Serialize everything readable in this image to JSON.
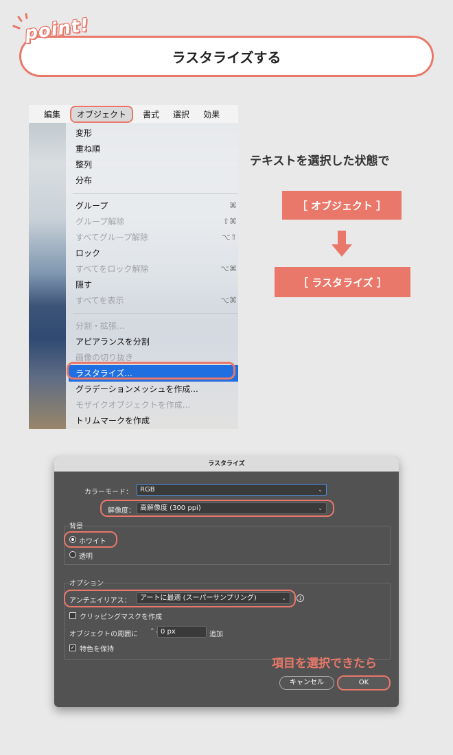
{
  "header": {
    "badge": "point!",
    "title": "ラスタライズする"
  },
  "menubar": [
    "編集",
    "オブジェクト",
    "書式",
    "選択",
    "効果"
  ],
  "dropdown": {
    "groups": [
      [
        {
          "label": "変形",
          "shortcut": "",
          "disabled": false
        },
        {
          "label": "重ね順",
          "shortcut": "",
          "disabled": false
        },
        {
          "label": "整列",
          "shortcut": "",
          "disabled": false
        },
        {
          "label": "分布",
          "shortcut": "",
          "disabled": false
        }
      ],
      [
        {
          "label": "グループ",
          "shortcut": "⌘",
          "disabled": false
        },
        {
          "label": "グループ解除",
          "shortcut": "⇧⌘",
          "disabled": true
        },
        {
          "label": "すべてグループ解除",
          "shortcut": "⌥⇧",
          "disabled": true
        },
        {
          "label": "ロック",
          "shortcut": "",
          "disabled": false
        },
        {
          "label": "すべてをロック解除",
          "shortcut": "⌥⌘",
          "disabled": true
        },
        {
          "label": "隠す",
          "shortcut": "",
          "disabled": false
        },
        {
          "label": "すべてを表示",
          "shortcut": "⌥⌘",
          "disabled": true
        }
      ],
      [
        {
          "label": "分割・拡張...",
          "shortcut": "",
          "disabled": true
        },
        {
          "label": "アピアランスを分割",
          "shortcut": "",
          "disabled": false
        },
        {
          "label": "画像の切り抜き",
          "shortcut": "",
          "disabled": true
        },
        {
          "label": "ラスタライズ...",
          "shortcut": "",
          "disabled": false,
          "selected": true
        },
        {
          "label": "グラデーションメッシュを作成...",
          "shortcut": "",
          "disabled": false
        },
        {
          "label": "モザイクオブジェクトを作成...",
          "shortcut": "",
          "disabled": true
        },
        {
          "label": "トリムマークを作成",
          "shortcut": "",
          "disabled": false
        }
      ]
    ]
  },
  "instructions": {
    "lead": "テキストを選択した状態で",
    "step1": "［ オブジェクト ］",
    "step2": "［ ラスタライズ ］"
  },
  "dialog": {
    "title": "ラスタライズ",
    "color_mode_label": "カラーモード：",
    "color_mode_value": "RGB",
    "resolution_label": "解像度：",
    "resolution_value": "高解像度 (300 ppi)",
    "background_label": "背景",
    "bg_white": "ホワイト",
    "bg_transparent": "透明",
    "options_label": "オプション",
    "antialias_label": "アンチエイリアス：",
    "antialias_value": "アートに最適 (スーパーサンプリング)",
    "clipping_mask": "クリッピングマスクを作成",
    "around_object_label": "オブジェクトの周囲に",
    "around_object_value": "0 px",
    "around_object_suffix": "追加",
    "preserve_spot": "特色を保持",
    "cancel": "キャンセル",
    "ok": "OK"
  },
  "note": "項目を選択できたら",
  "colors": {
    "accent": "#e9786a",
    "dialog_bg": "#525252",
    "highlight": "#1f6fe0"
  }
}
